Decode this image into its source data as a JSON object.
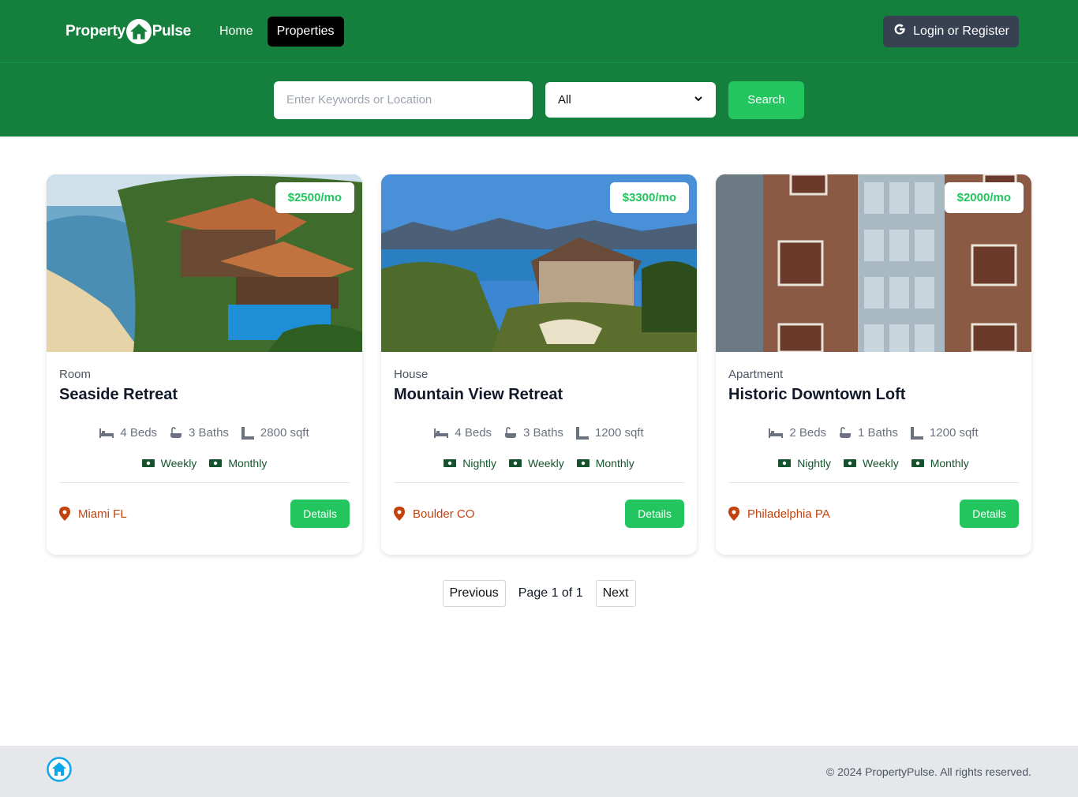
{
  "nav": {
    "logo_left": "Property",
    "logo_right": "Pulse",
    "links": [
      {
        "label": "Home",
        "active": false
      },
      {
        "label": "Properties",
        "active": true
      }
    ],
    "login_label": "Login or Register",
    "login_icon": "google-icon"
  },
  "search": {
    "placeholder": "Enter Keywords or Location",
    "type_selected": "All",
    "button_label": "Search"
  },
  "properties": [
    {
      "price": "$2500/mo",
      "type": "Room",
      "name": "Seaside Retreat",
      "beds": "4 Beds",
      "baths": "3 Baths",
      "sqft": "2800 sqft",
      "rates": [
        "Weekly",
        "Monthly"
      ],
      "location": "Miami FL",
      "details_label": "Details"
    },
    {
      "price": "$3300/mo",
      "type": "House",
      "name": "Mountain View Retreat",
      "beds": "4 Beds",
      "baths": "3 Baths",
      "sqft": "1200 sqft",
      "rates": [
        "Nightly",
        "Weekly",
        "Monthly"
      ],
      "location": "Boulder CO",
      "details_label": "Details"
    },
    {
      "price": "$2000/mo",
      "type": "Apartment",
      "name": "Historic Downtown Loft",
      "beds": "2 Beds",
      "baths": "1 Baths",
      "sqft": "1200 sqft",
      "rates": [
        "Nightly",
        "Weekly",
        "Monthly"
      ],
      "location": "Philadelphia PA",
      "details_label": "Details"
    }
  ],
  "pagination": {
    "previous_label": "Previous",
    "page_text": "Page 1 of 1",
    "next_label": "Next"
  },
  "footer": {
    "copyright": "© 2024 PropertyPulse. All rights reserved."
  },
  "colors": {
    "brand_green": "#15803d",
    "accent_green": "#22c55e",
    "location_orange": "#c2410c"
  }
}
